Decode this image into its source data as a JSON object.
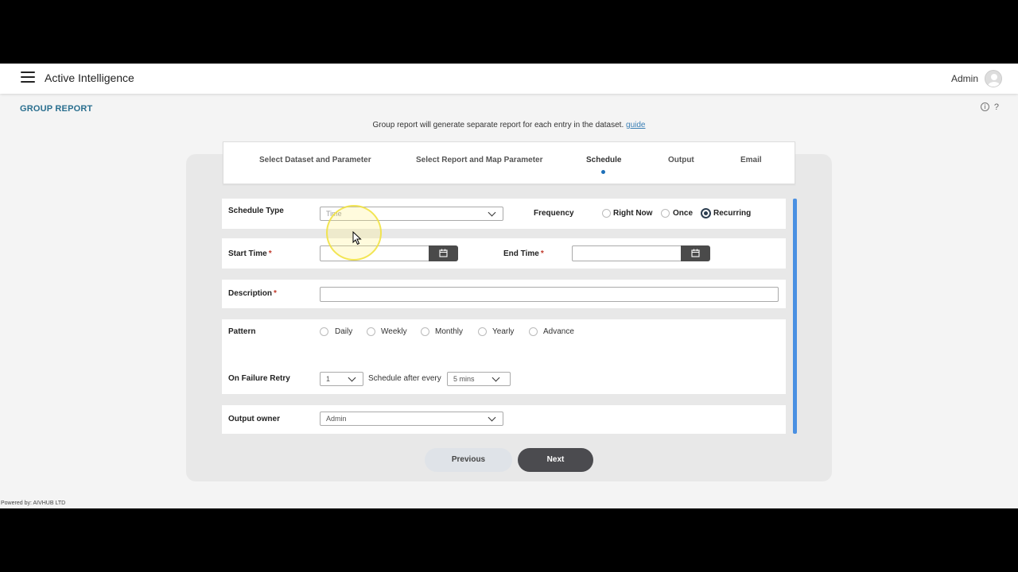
{
  "header": {
    "app_title": "Active Intelligence",
    "user_name": "Admin"
  },
  "page": {
    "title": "GROUP REPORT",
    "subtitle": "Group report will generate separate report for each entry in the dataset.",
    "guide_link": "guide",
    "help_icon": "?",
    "info_icon": "i"
  },
  "steps": [
    {
      "label": "Select Dataset and Parameter"
    },
    {
      "label": "Select Report and Map Parameter"
    },
    {
      "label": "Schedule",
      "active": true
    },
    {
      "label": "Output"
    },
    {
      "label": "Email"
    }
  ],
  "form": {
    "schedule_type": {
      "label": "Schedule Type",
      "value": "Time"
    },
    "frequency": {
      "label": "Frequency",
      "options": [
        "Right Now",
        "Once",
        "Recurring"
      ],
      "selected": "Recurring"
    },
    "start_time": {
      "label": "Start Time",
      "required": "*",
      "value": ""
    },
    "end_time": {
      "label": "End Time",
      "required": "*",
      "value": ""
    },
    "description": {
      "label": "Description",
      "required": "*",
      "value": ""
    },
    "pattern": {
      "label": "Pattern",
      "options": [
        "Daily",
        "Weekly",
        "Monthly",
        "Yearly",
        "Advance"
      ]
    },
    "failure_retry": {
      "label": "On Failure Retry",
      "value": "1",
      "schedule_after_label": "Schedule after every",
      "schedule_after_value": "5 mins"
    },
    "output_owner": {
      "label": "Output owner",
      "value": "Admin"
    }
  },
  "buttons": {
    "previous": "Previous",
    "next": "Next"
  },
  "footer": {
    "powered_by": "Powered by: AIVHUB LTD"
  },
  "colors": {
    "accent": "#1d6fb8",
    "title": "#2a6f8f",
    "primary_button": "#4b4b4f",
    "scrollbar": "#4a90e2",
    "required": "#c0392b"
  }
}
